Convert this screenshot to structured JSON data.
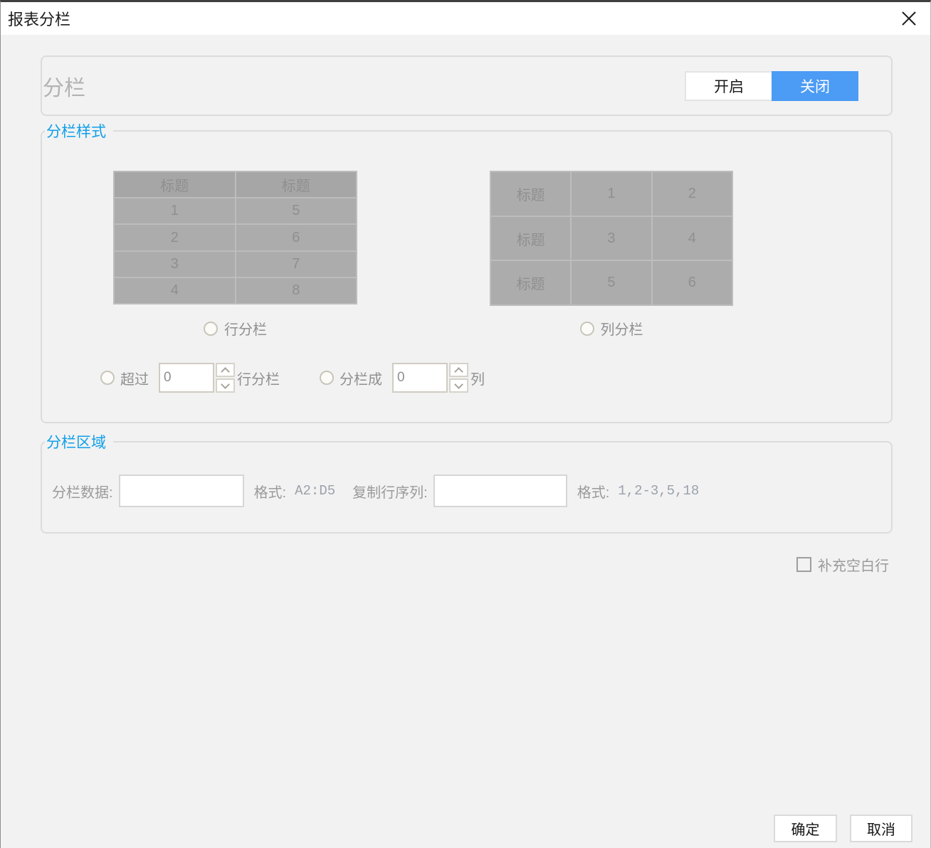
{
  "window": {
    "title": "报表分栏"
  },
  "toggle_group": {
    "label": "分栏",
    "on_label": "开启",
    "off_label": "关闭",
    "selected": "off_label"
  },
  "style_section": {
    "legend": "分栏样式",
    "row_table": {
      "rows": [
        [
          "标题",
          "标题"
        ],
        [
          "1",
          "5"
        ],
        [
          "2",
          "6"
        ],
        [
          "3",
          "7"
        ],
        [
          "4",
          "8"
        ]
      ]
    },
    "col_table": {
      "rows": [
        [
          "标题",
          "1",
          "2"
        ],
        [
          "标题",
          "3",
          "4"
        ],
        [
          "标题",
          "5",
          "6"
        ]
      ]
    },
    "row_split_label": "行分栏",
    "col_split_label": "列分栏",
    "exceed_prefix": "超过",
    "exceed_value": "0",
    "exceed_suffix": "行分栏",
    "into_prefix": "分栏成",
    "into_value": "0",
    "into_suffix": "列"
  },
  "area_section": {
    "legend": "分栏区域",
    "data_label": "分栏数据:",
    "data_value": "",
    "format_label_1": "格式:",
    "format_example_1": "A2:D5",
    "copy_rows_label": "复制行序列:",
    "copy_rows_value": "",
    "format_label_2": "格式:",
    "format_example_2": "1,2-3,5,18"
  },
  "fill_blank_checkbox": {
    "label": "补充空白行",
    "checked": false
  },
  "footer": {
    "ok_label": "确定",
    "cancel_label": "取消"
  },
  "colors": {
    "accent_blue": "#4c9bf5",
    "section_title_blue": "#0f9fe9",
    "preview_gray": "#acacac"
  }
}
